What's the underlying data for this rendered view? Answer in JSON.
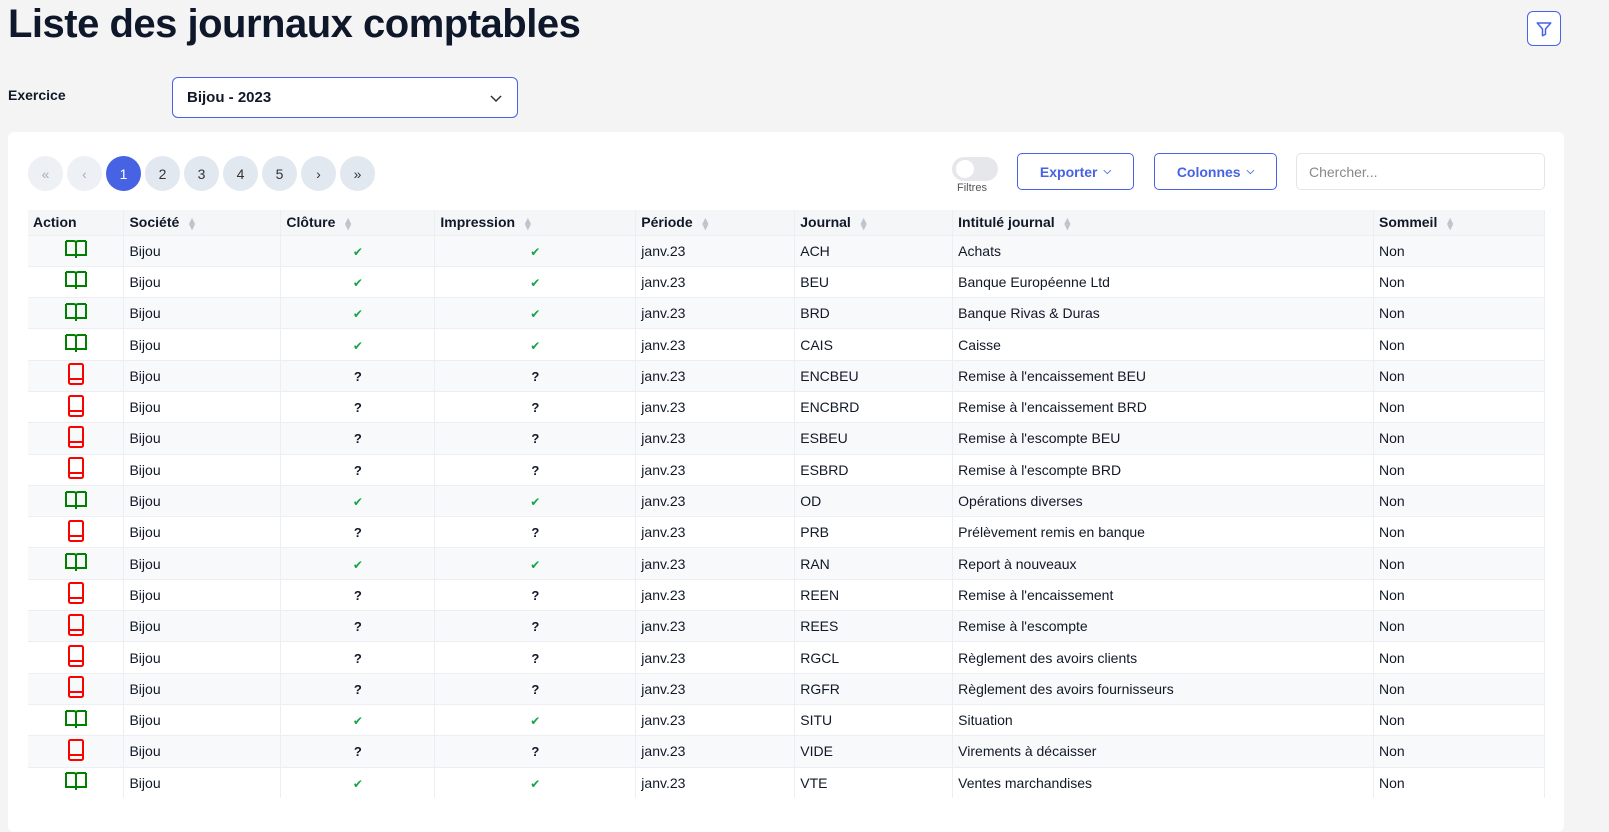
{
  "title": "Liste des journaux comptables",
  "exercice": {
    "label": "Exercice",
    "value": "Bijou - 2023"
  },
  "pagination": {
    "pages": [
      "1",
      "2",
      "3",
      "4",
      "5"
    ],
    "current": "1"
  },
  "toolbar": {
    "filters_label": "Filtres",
    "export_label": "Exporter",
    "columns_label": "Colonnes",
    "search_placeholder": "Chercher..."
  },
  "colors": {
    "accent": "#4763e4",
    "open": "#008000",
    "closed": "#ff0000",
    "check": "#16a34a"
  },
  "columns": [
    "Action",
    "Société",
    "Clôture",
    "Impression",
    "Période",
    "Journal",
    "Intitulé journal",
    "Sommeil"
  ],
  "rows": [
    {
      "status": "open",
      "societe": "Bijou",
      "cloture": "✔",
      "impression": "✔",
      "periode": "janv.23",
      "journal": "ACH",
      "intitule": "Achats",
      "sommeil": "Non"
    },
    {
      "status": "open",
      "societe": "Bijou",
      "cloture": "✔",
      "impression": "✔",
      "periode": "janv.23",
      "journal": "BEU",
      "intitule": "Banque Européenne Ltd",
      "sommeil": "Non"
    },
    {
      "status": "open",
      "societe": "Bijou",
      "cloture": "✔",
      "impression": "✔",
      "periode": "janv.23",
      "journal": "BRD",
      "intitule": "Banque Rivas & Duras",
      "sommeil": "Non"
    },
    {
      "status": "open",
      "societe": "Bijou",
      "cloture": "✔",
      "impression": "✔",
      "periode": "janv.23",
      "journal": "CAIS",
      "intitule": "Caisse",
      "sommeil": "Non"
    },
    {
      "status": "closed",
      "societe": "Bijou",
      "cloture": "?",
      "impression": "?",
      "periode": "janv.23",
      "journal": "ENCBEU",
      "intitule": "Remise à l'encaissement BEU",
      "sommeil": "Non"
    },
    {
      "status": "closed",
      "societe": "Bijou",
      "cloture": "?",
      "impression": "?",
      "periode": "janv.23",
      "journal": "ENCBRD",
      "intitule": "Remise à l'encaissement BRD",
      "sommeil": "Non"
    },
    {
      "status": "closed",
      "societe": "Bijou",
      "cloture": "?",
      "impression": "?",
      "periode": "janv.23",
      "journal": "ESBEU",
      "intitule": "Remise à l'escompte BEU",
      "sommeil": "Non"
    },
    {
      "status": "closed",
      "societe": "Bijou",
      "cloture": "?",
      "impression": "?",
      "periode": "janv.23",
      "journal": "ESBRD",
      "intitule": "Remise à l'escompte BRD",
      "sommeil": "Non"
    },
    {
      "status": "open",
      "societe": "Bijou",
      "cloture": "✔",
      "impression": "✔",
      "periode": "janv.23",
      "journal": "OD",
      "intitule": "Opérations diverses",
      "sommeil": "Non"
    },
    {
      "status": "closed",
      "societe": "Bijou",
      "cloture": "?",
      "impression": "?",
      "periode": "janv.23",
      "journal": "PRB",
      "intitule": "Prélèvement remis en banque",
      "sommeil": "Non"
    },
    {
      "status": "open",
      "societe": "Bijou",
      "cloture": "✔",
      "impression": "✔",
      "periode": "janv.23",
      "journal": "RAN",
      "intitule": "Report à nouveaux",
      "sommeil": "Non"
    },
    {
      "status": "closed",
      "societe": "Bijou",
      "cloture": "?",
      "impression": "?",
      "periode": "janv.23",
      "journal": "REEN",
      "intitule": "Remise à l'encaissement",
      "sommeil": "Non"
    },
    {
      "status": "closed",
      "societe": "Bijou",
      "cloture": "?",
      "impression": "?",
      "periode": "janv.23",
      "journal": "REES",
      "intitule": "Remise à l'escompte",
      "sommeil": "Non"
    },
    {
      "status": "closed",
      "societe": "Bijou",
      "cloture": "?",
      "impression": "?",
      "periode": "janv.23",
      "journal": "RGCL",
      "intitule": "Règlement des avoirs clients",
      "sommeil": "Non"
    },
    {
      "status": "closed",
      "societe": "Bijou",
      "cloture": "?",
      "impression": "?",
      "periode": "janv.23",
      "journal": "RGFR",
      "intitule": "Règlement des avoirs fournisseurs",
      "sommeil": "Non"
    },
    {
      "status": "open",
      "societe": "Bijou",
      "cloture": "✔",
      "impression": "✔",
      "periode": "janv.23",
      "journal": "SITU",
      "intitule": "Situation",
      "sommeil": "Non"
    },
    {
      "status": "closed",
      "societe": "Bijou",
      "cloture": "?",
      "impression": "?",
      "periode": "janv.23",
      "journal": "VIDE",
      "intitule": "Virements à décaisser",
      "sommeil": "Non"
    },
    {
      "status": "open",
      "societe": "Bijou",
      "cloture": "✔",
      "impression": "✔",
      "periode": "janv.23",
      "journal": "VTE",
      "intitule": "Ventes marchandises",
      "sommeil": "Non"
    }
  ]
}
